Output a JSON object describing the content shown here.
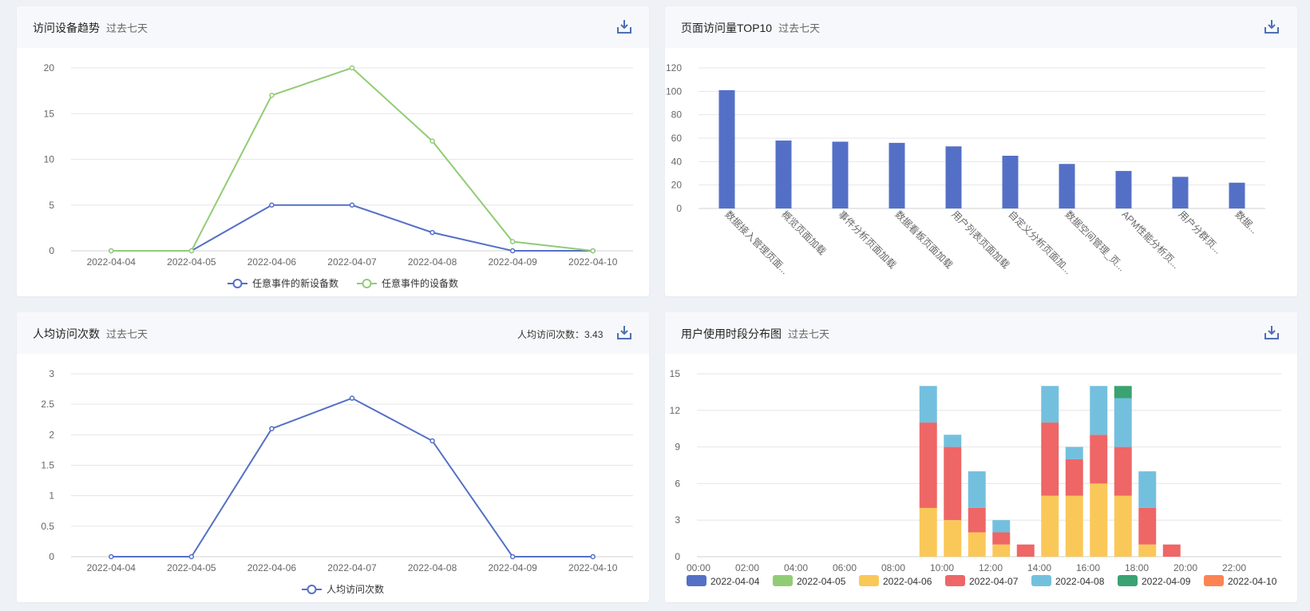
{
  "colors": {
    "blue": "#5470c6",
    "green": "#91cc75",
    "yellow": "#fac858",
    "red": "#ee6666",
    "cyan": "#73c0de",
    "teal": "#3ba272",
    "orange": "#fc8452"
  },
  "panels": {
    "trend": {
      "title": "访问设备趋势",
      "subtitle": "过去七天",
      "download_icon": "download-icon"
    },
    "top10": {
      "title": "页面访问量TOP10",
      "subtitle": "过去七天",
      "download_icon": "download-icon"
    },
    "avg": {
      "title": "人均访问次数",
      "subtitle": "过去七天",
      "metric_label": "人均访问次数：",
      "metric_value": "3.43",
      "download_icon": "download-icon"
    },
    "hours": {
      "title": "用户使用时段分布图",
      "subtitle": "过去七天",
      "download_icon": "download-icon"
    }
  },
  "chart_data": [
    {
      "id": "trend",
      "type": "line",
      "x": [
        "2022-04-04",
        "2022-04-05",
        "2022-04-06",
        "2022-04-07",
        "2022-04-08",
        "2022-04-09",
        "2022-04-10"
      ],
      "ylim": [
        0,
        20
      ],
      "yticks": [
        "0",
        "5",
        "10",
        "15",
        "20"
      ],
      "series": [
        {
          "name": "任意事件的新设备数",
          "color": "#5470c6",
          "values": [
            0,
            0,
            5,
            5,
            2,
            0,
            0
          ]
        },
        {
          "name": "任意事件的设备数",
          "color": "#91cc75",
          "values": [
            0,
            0,
            17,
            20,
            12,
            1,
            0
          ]
        }
      ],
      "legend": "bottom",
      "grid": true
    },
    {
      "id": "top10",
      "type": "bar",
      "categories": [
        "数据接入管理页面...",
        "概览页面加载",
        "事件分析页面加载",
        "数据看板页面加载",
        "用户列表页面加载",
        "自定义分析页面加...",
        "数据空间管理_页...",
        "APM性能分析页...",
        "用户分群页...",
        "数据..."
      ],
      "values": [
        101,
        58,
        57,
        56,
        53,
        45,
        38,
        32,
        27,
        22
      ],
      "ylim": [
        0,
        120
      ],
      "yticks": [
        "0",
        "20",
        "40",
        "60",
        "80",
        "100",
        "120"
      ],
      "color": "#5470c6",
      "grid": true
    },
    {
      "id": "avg",
      "type": "line",
      "x": [
        "2022-04-04",
        "2022-04-05",
        "2022-04-06",
        "2022-04-07",
        "2022-04-08",
        "2022-04-09",
        "2022-04-10"
      ],
      "ylim": [
        0,
        3
      ],
      "yticks": [
        "0",
        "0.5",
        "1",
        "1.5",
        "2",
        "2.5",
        "3"
      ],
      "series": [
        {
          "name": "人均访问次数",
          "color": "#5470c6",
          "values": [
            0,
            0,
            2.1,
            2.6,
            1.9,
            0,
            0
          ]
        }
      ],
      "legend": "bottom",
      "grid": true
    },
    {
      "id": "hours",
      "type": "bar",
      "stacked": true,
      "categories": [
        "00:00",
        "01:00",
        "02:00",
        "03:00",
        "04:00",
        "05:00",
        "06:00",
        "07:00",
        "08:00",
        "09:00",
        "10:00",
        "11:00",
        "12:00",
        "13:00",
        "14:00",
        "15:00",
        "16:00",
        "17:00",
        "18:00",
        "19:00",
        "20:00",
        "21:00",
        "22:00",
        "23:00"
      ],
      "xticks": [
        "00:00",
        "02:00",
        "04:00",
        "06:00",
        "08:00",
        "10:00",
        "12:00",
        "14:00",
        "16:00",
        "18:00",
        "20:00",
        "22:00"
      ],
      "ylim": [
        0,
        15
      ],
      "yticks": [
        "0",
        "3",
        "6",
        "9",
        "12",
        "15"
      ],
      "series": [
        {
          "name": "2022-04-04",
          "color": "#5470c6",
          "values": [
            0,
            0,
            0,
            0,
            0,
            0,
            0,
            0,
            0,
            0,
            0,
            0,
            0,
            0,
            0,
            0,
            0,
            0,
            0,
            0,
            0,
            0,
            0,
            0
          ]
        },
        {
          "name": "2022-04-05",
          "color": "#91cc75",
          "values": [
            0,
            0,
            0,
            0,
            0,
            0,
            0,
            0,
            0,
            0,
            0,
            0,
            0,
            0,
            0,
            0,
            0,
            0,
            0,
            0,
            0,
            0,
            0,
            0
          ]
        },
        {
          "name": "2022-04-06",
          "color": "#fac858",
          "values": [
            0,
            0,
            0,
            0,
            0,
            0,
            0,
            0,
            0,
            4,
            3,
            2,
            1,
            0,
            5,
            5,
            6,
            5,
            1,
            0,
            0,
            0,
            0,
            0
          ]
        },
        {
          "name": "2022-04-07",
          "color": "#ee6666",
          "values": [
            0,
            0,
            0,
            0,
            0,
            0,
            0,
            0,
            0,
            7,
            6,
            2,
            1,
            1,
            6,
            3,
            4,
            4,
            3,
            1,
            0,
            0,
            0,
            0
          ]
        },
        {
          "name": "2022-04-08",
          "color": "#73c0de",
          "values": [
            0,
            0,
            0,
            0,
            0,
            0,
            0,
            0,
            0,
            3,
            1,
            3,
            1,
            0,
            3,
            1,
            4,
            4,
            3,
            0,
            0,
            0,
            0,
            0
          ]
        },
        {
          "name": "2022-04-09",
          "color": "#3ba272",
          "values": [
            0,
            0,
            0,
            0,
            0,
            0,
            0,
            0,
            0,
            0,
            0,
            0,
            0,
            0,
            0,
            0,
            0,
            1,
            0,
            0,
            0,
            0,
            0,
            0
          ]
        },
        {
          "name": "2022-04-10",
          "color": "#fc8452",
          "values": [
            0,
            0,
            0,
            0,
            0,
            0,
            0,
            0,
            0,
            0,
            0,
            0,
            0,
            0,
            0,
            0,
            0,
            0,
            0,
            0,
            0,
            0,
            0,
            0
          ]
        }
      ],
      "legend": "bottom",
      "grid": true
    }
  ]
}
